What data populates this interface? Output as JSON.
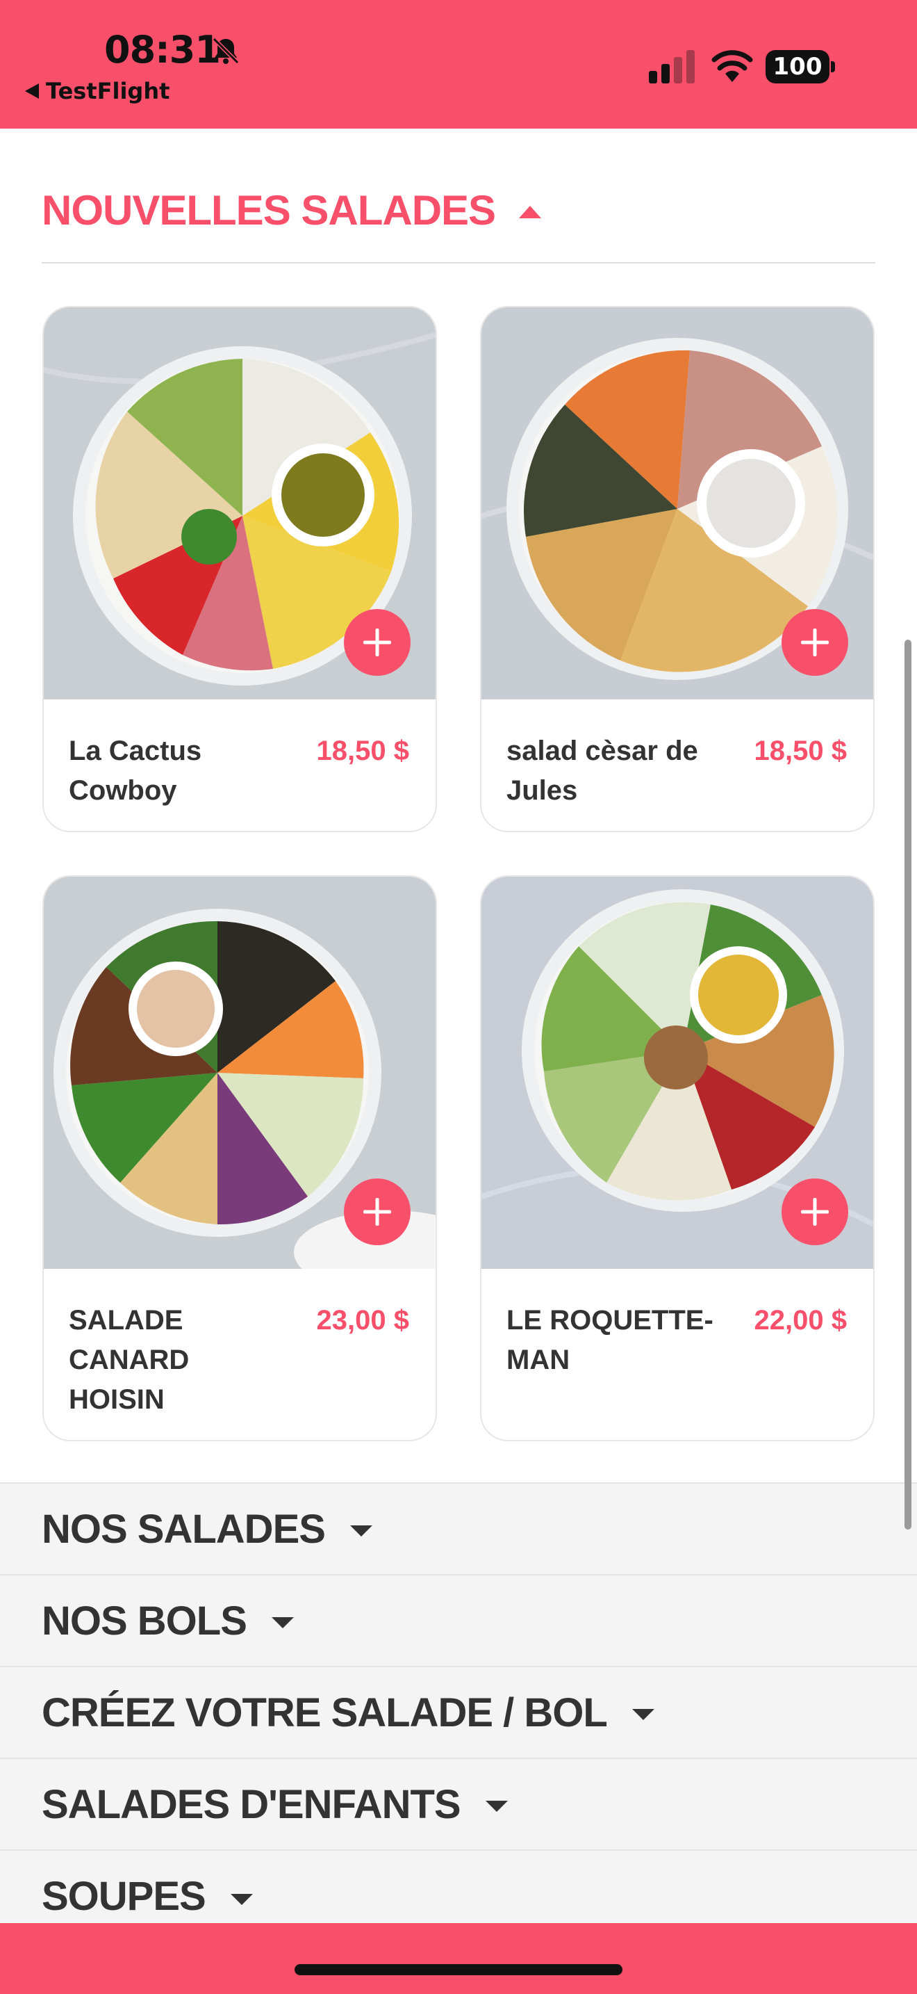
{
  "status": {
    "time": "08:31",
    "back_label": "TestFlight",
    "battery": "100"
  },
  "section": {
    "title": "NOUVELLES SALADES"
  },
  "products": [
    {
      "name": "La Cactus Cowboy",
      "price": "18,50 $"
    },
    {
      "name": "salad cèsar de Jules",
      "price": "18,50 $"
    },
    {
      "name": "SALADE CANARD HOISIN",
      "price": "23,00 $"
    },
    {
      "name": "LE ROQUETTE-MAN",
      "price": "22,00 $"
    }
  ],
  "categories": [
    {
      "label": "NOS SALADES"
    },
    {
      "label": "NOS BOLS"
    },
    {
      "label": "CRÉEZ VOTRE SALADE / BOL"
    },
    {
      "label": "SALADES D'ENFANTS"
    },
    {
      "label": "SOUPES"
    }
  ],
  "colors": {
    "brand": "#f8506a",
    "text": "#333333",
    "category_bg": "#f4f4f4"
  },
  "icons": [
    "bell-slash-icon",
    "back-arrow-icon",
    "cellular-signal-icon",
    "wifi-icon",
    "battery-icon",
    "add-icon",
    "caret-up-icon",
    "caret-down-icon"
  ]
}
